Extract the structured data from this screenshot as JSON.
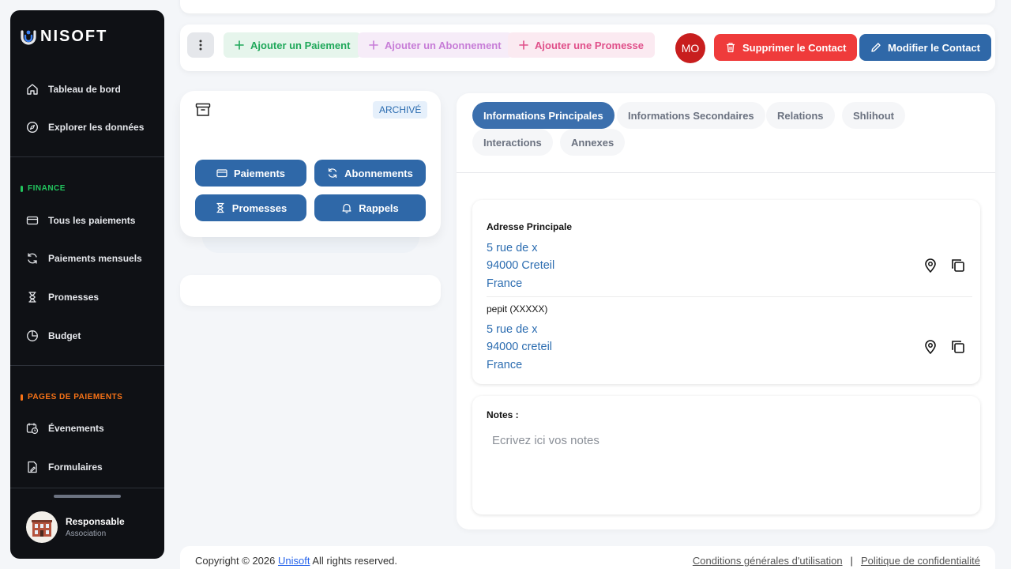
{
  "brand": {
    "name": "NISOFT"
  },
  "sidebar": {
    "items_top": [
      {
        "label": "Tableau de bord"
      },
      {
        "label": "Explorer les données"
      }
    ],
    "finance": {
      "label": "FINANCE",
      "color": "#22c55e",
      "items": [
        {
          "label": "Tous les paiements"
        },
        {
          "label": "Paiements mensuels"
        },
        {
          "label": "Promesses"
        },
        {
          "label": "Budget"
        }
      ]
    },
    "payment_pages": {
      "label": "PAGES DE PAIEMENTS",
      "color": "#f97316",
      "items": [
        {
          "label": "Évenements"
        },
        {
          "label": "Formulaires"
        }
      ]
    },
    "user": {
      "name": "Responsable",
      "role": "Association"
    }
  },
  "actions": {
    "add_payment": "Ajouter un Paiement",
    "add_subscription": "Ajouter un Abonnement",
    "add_promise": "Ajouter une Promesse",
    "avatar_initials": "MO",
    "delete_contact": "Supprimer le Contact",
    "edit_contact": "Modifier le Contact"
  },
  "contact_card": {
    "status": "ARCHIVÉ",
    "buttons": {
      "payments": "Paiements",
      "subscriptions": "Abonnements",
      "promises": "Promesses",
      "reminders": "Rappels"
    }
  },
  "tabs": [
    {
      "label": "Informations Principales",
      "active": true
    },
    {
      "label": "Informations Secondaires"
    },
    {
      "label": "Relations"
    },
    {
      "label": "Shlihout"
    },
    {
      "label": "Interactions"
    },
    {
      "label": "Annexes"
    }
  ],
  "addresses": {
    "title": "Adresse Principale",
    "primary": {
      "line1": "5 rue de x",
      "line2": "94000 Creteil",
      "line3": "France"
    },
    "secondary_label": "pepit (XXXXX)",
    "secondary": {
      "line1": "5 rue de x",
      "line2": "94000 creteil",
      "line3": "France"
    }
  },
  "notes": {
    "label": "Notes :",
    "placeholder": "Ecrivez ici vos notes"
  },
  "footer": {
    "copyright_prefix": "Copyright © 2026",
    "brand_link": "Unisoft",
    "copyright_suffix": "All rights reserved.",
    "terms": "Conditions générales d'utilisation",
    "separator": "|",
    "privacy": "Politique de confidentialité"
  },
  "colors": {
    "sidebar_bg": "#0f1115",
    "primary_blue": "#2f68a8",
    "delete_red": "#ef3b3b",
    "add_payment": "#1fa85a",
    "add_subscription": "#c77dd7",
    "add_promise": "#e0508a"
  }
}
